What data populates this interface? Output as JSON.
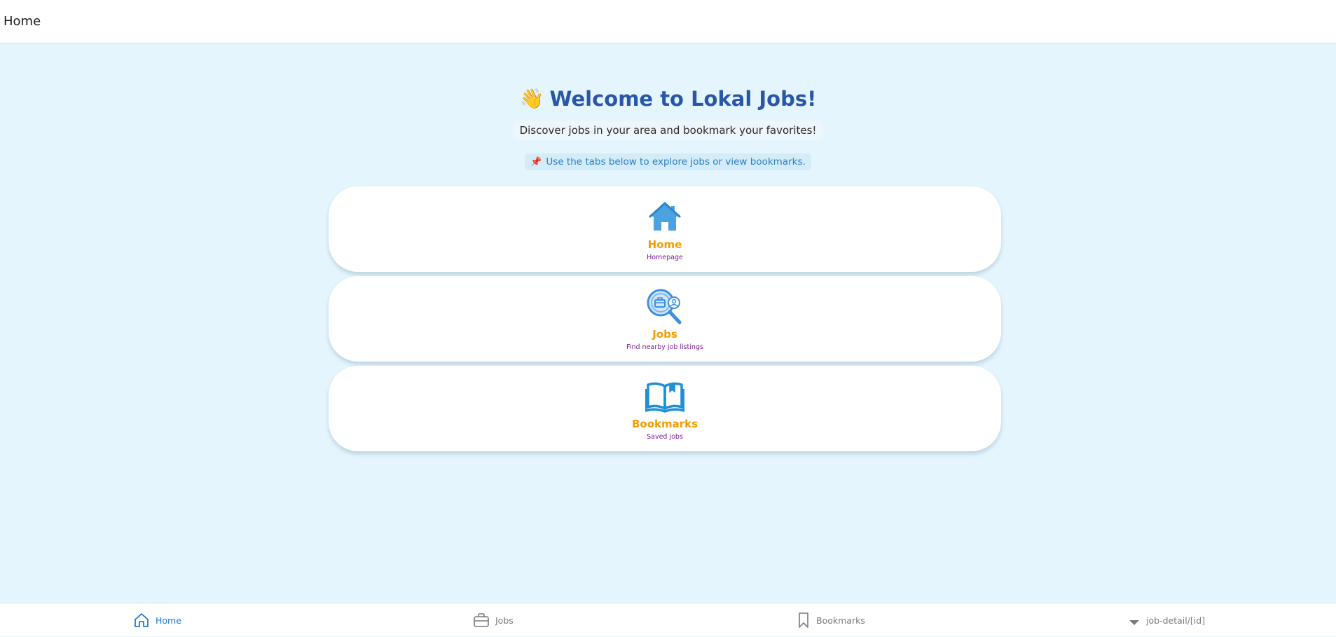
{
  "header": {
    "title": "Home"
  },
  "welcome": {
    "emoji": "👋",
    "title": "Welcome to Lokal Jobs!",
    "subtitle": "Discover jobs in your area and bookmark your favorites!",
    "tip_emoji": "📌",
    "tip": "Use the tabs below to explore jobs or view bookmarks."
  },
  "cards": [
    {
      "title": "Home",
      "subtitle": "Homepage",
      "icon": "house-icon"
    },
    {
      "title": "Jobs",
      "subtitle": "Find nearby job listings",
      "icon": "job-search-icon"
    },
    {
      "title": "Bookmarks",
      "subtitle": "Saved jobs",
      "icon": "open-book-icon"
    }
  ],
  "tabs": [
    {
      "label": "Home",
      "icon": "home-icon",
      "active": true
    },
    {
      "label": "Jobs",
      "icon": "briefcase-icon",
      "active": false
    },
    {
      "label": "Bookmarks",
      "icon": "bookmark-icon",
      "active": false
    },
    {
      "label": "job-detail/[id]",
      "icon": "caret-down-icon",
      "active": false
    }
  ],
  "colors": {
    "background": "#e4f5fd",
    "title": "#2a56a8",
    "card_title": "#f59d00",
    "card_subtitle": "#7a1e9a",
    "active_tab": "#1e7ad6",
    "inactive_tab": "#7a7a7a"
  }
}
